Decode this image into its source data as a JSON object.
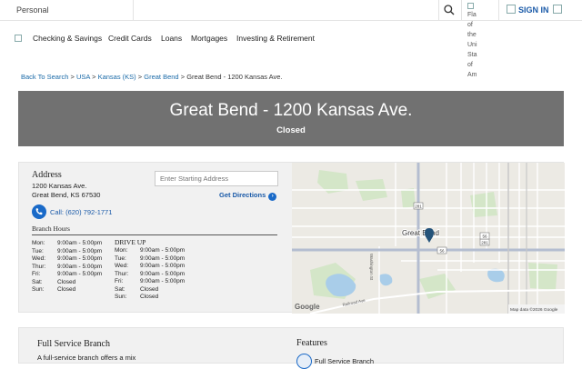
{
  "topbar": {
    "segment_label": "Personal",
    "flag_alt_lines": [
      "Fla",
      "of",
      "the",
      "Uni",
      "Sta",
      "of",
      "Am"
    ],
    "sign_in_label": "SIGN IN"
  },
  "nav": {
    "items": [
      "Checking & Savings",
      "Credit Cards",
      "Loans",
      "Mortgages",
      "Investing & Retirement"
    ]
  },
  "breadcrumb": {
    "links": [
      "Back To Search",
      "USA",
      "Kansas (KS)",
      "Great Bend"
    ],
    "separator": ">",
    "current": "Great Bend - 1200 Kansas Ave."
  },
  "banner": {
    "title": "Great Bend - 1200 Kansas Ave.",
    "status": "Closed"
  },
  "branch": {
    "address_heading": "Address",
    "address_line1": "1200 Kansas Ave.",
    "address_line2": "Great Bend, KS 67530",
    "start_placeholder": "Enter Starting Address",
    "directions_label": "Get Directions",
    "call_label": "Call: (620) 792-1771",
    "hours_heading": "Branch Hours",
    "branch_hours": [
      {
        "day": "Mon:",
        "hours": "9:00am - 5:00pm"
      },
      {
        "day": "Tue:",
        "hours": "9:00am - 5:00pm"
      },
      {
        "day": "Wed:",
        "hours": "9:00am - 5:00pm"
      },
      {
        "day": "Thur:",
        "hours": "9:00am - 5:00pm"
      },
      {
        "day": "Fri:",
        "hours": "9:00am - 5:00pm"
      },
      {
        "day": "Sat:",
        "hours": "Closed"
      },
      {
        "day": "Sun:",
        "hours": "Closed"
      }
    ],
    "drive_heading": "DRIVE UP",
    "drive_hours": [
      {
        "day": "Mon:",
        "hours": "9:00am - 5:00pm"
      },
      {
        "day": "Tue:",
        "hours": "9:00am - 5:00pm"
      },
      {
        "day": "Wed:",
        "hours": "9:00am - 5:00pm"
      },
      {
        "day": "Thur:",
        "hours": "9:00am - 5:00pm"
      },
      {
        "day": "Fri:",
        "hours": "9:00am - 5:00pm"
      },
      {
        "day": "Sat:",
        "hours": "Closed"
      },
      {
        "day": "Sun:",
        "hours": "Closed"
      }
    ]
  },
  "map": {
    "city_label": "Great Bend",
    "street_label_1": "Washington St",
    "street_label_2": "Railroad Ave",
    "route_labels": [
      "281",
      "56",
      "281",
      "56"
    ],
    "provider": "Google",
    "attribution": "Map data ©2026 Google"
  },
  "services": {
    "heading": "Full Service Branch",
    "text": "A full-service branch offers a mix",
    "features_heading": "Features",
    "feature_item": "Full Service Branch"
  },
  "colors": {
    "link": "#1a5aa8",
    "banner": "#717171",
    "accent": "#1a6ac8"
  }
}
